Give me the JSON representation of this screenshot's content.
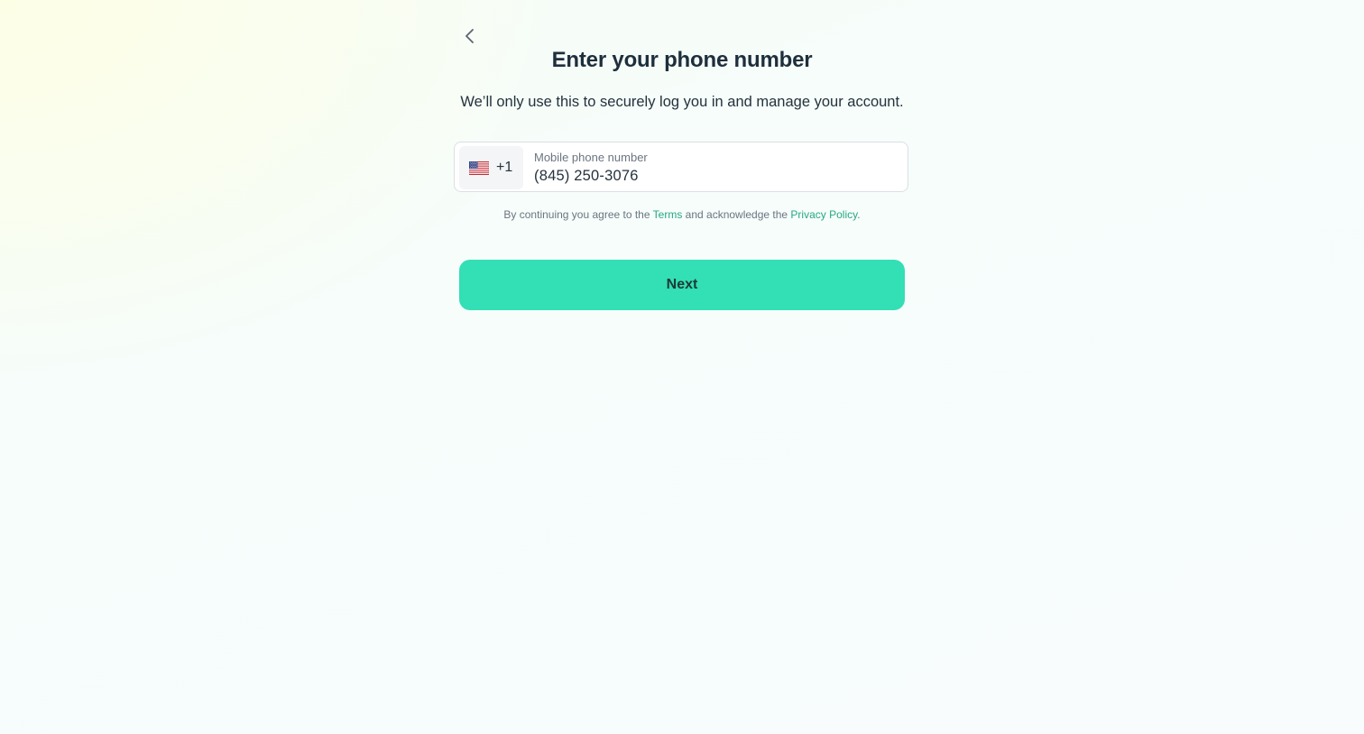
{
  "header": {
    "back_icon": "chevron-left-icon",
    "title": "Enter your phone number",
    "subtitle": "We’ll only use this to securely log you in and manage your account."
  },
  "phone": {
    "country_flag_icon": "us-flag-icon",
    "dial_code": "+1",
    "label": "Mobile phone number",
    "value": "(845) 250-3076"
  },
  "legal": {
    "prefix": "By continuing you agree to the ",
    "terms_link": "Terms",
    "middle": " and acknowledge the ",
    "privacy_link": "Privacy Policy",
    "suffix": "."
  },
  "actions": {
    "next_label": "Next"
  },
  "colors": {
    "accent": "#33dfb5",
    "link": "#27a883",
    "title_text": "#1e2f3c",
    "muted_text": "#6b7580"
  }
}
